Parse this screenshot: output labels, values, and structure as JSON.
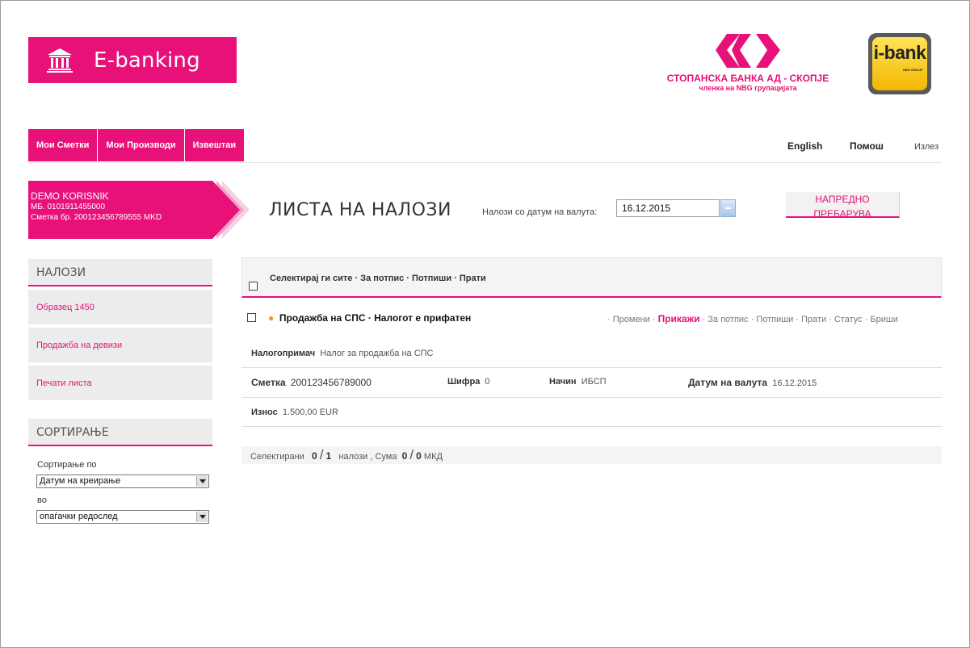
{
  "header": {
    "app_title": "E-banking",
    "bank_name": "СТОПАНСКА БАНКА АД - СКОПЈЕ",
    "bank_subtitle": "членка на NBG групацијата",
    "ibank_label": "i-bank",
    "ibank_sub": "NBG GROUP",
    "brand_color": "#e8117a"
  },
  "nav": {
    "items": [
      "Мои Сметки",
      "Мои Производи",
      "Извештаи"
    ],
    "english": "English",
    "help": "Помош",
    "logout": "Излез"
  },
  "user": {
    "name": "DEMO KORISNIK",
    "mb": "МБ. 0101911455000",
    "account": "Сметка бр. 200123456789555 MKD"
  },
  "page": {
    "title": "ЛИСТА НА НАЛОЗИ",
    "date_label": "Налози со датум на валута:",
    "date_value": "16.12.2015",
    "advanced_search": "НАПРЕДНО ПРЕБАРУВА"
  },
  "sidebar": {
    "orders_heading": "НАЛОЗИ",
    "orders_items": [
      "Образец 1450",
      "Продажба на девизи",
      "Печати листа"
    ],
    "sort_heading": "СОРТИРАЊЕ",
    "sort_by_label": "Сортирање по",
    "sort_by_value": "Датум на креирање",
    "in_label": "во",
    "order_value": "опаѓачки редослед"
  },
  "orders": {
    "header_actions": "Селектирај ги сите · За потпис · Потпиши · Прати",
    "item": {
      "title": "Продажба на СПС · Налогот е прифатен",
      "actions": [
        "Промени",
        "Прикажи",
        "За потпис",
        "Потпиши",
        "Прати",
        "Статус",
        "Бриши"
      ],
      "recipient_label": "Налогопримач",
      "recipient_value": "Налог за продажба на СПС",
      "account_label": "Сметка",
      "account_value": "200123456789000",
      "code_label": "Шифра",
      "code_value": "0",
      "method_label": "Начин",
      "method_value": "ИБСП",
      "value_date_label": "Датум на валута",
      "value_date_value": "16.12.2015",
      "amount_label": "Износ",
      "amount_value": "1.500,00 EUR"
    }
  },
  "summary": {
    "selected_label": "Селектирани",
    "selected_count": "0",
    "total_count": "1",
    "orders_word": "налози",
    "sum_label": ", Сума",
    "sum_selected": "0",
    "sum_total": "0",
    "currency": "МКД"
  }
}
